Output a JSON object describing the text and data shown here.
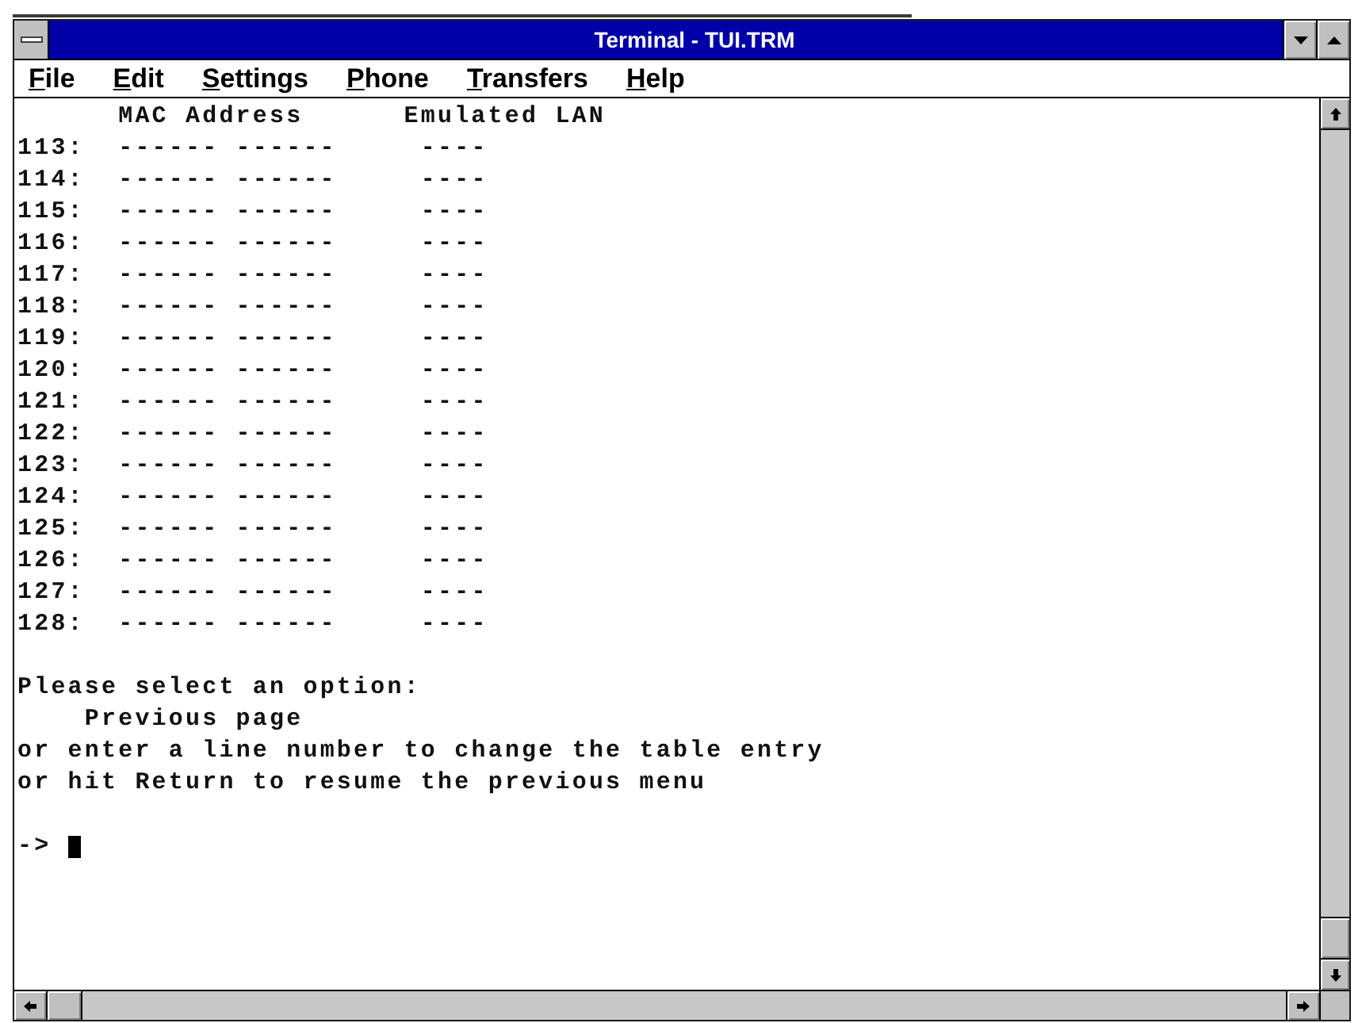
{
  "window": {
    "title": "Terminal - TUI.TRM"
  },
  "menu": [
    "File",
    "Edit",
    "Settings",
    "Phone",
    "Transfers",
    "Help"
  ],
  "terminal": {
    "columns": [
      "MAC Address",
      "Emulated LAN"
    ],
    "rows": [
      {
        "line": "113:",
        "mac_address": "------ ------",
        "emulated_lan": "----"
      },
      {
        "line": "114:",
        "mac_address": "------ ------",
        "emulated_lan": "----"
      },
      {
        "line": "115:",
        "mac_address": "------ ------",
        "emulated_lan": "----"
      },
      {
        "line": "116:",
        "mac_address": "------ ------",
        "emulated_lan": "----"
      },
      {
        "line": "117:",
        "mac_address": "------ ------",
        "emulated_lan": "----"
      },
      {
        "line": "118:",
        "mac_address": "------ ------",
        "emulated_lan": "----"
      },
      {
        "line": "119:",
        "mac_address": "------ ------",
        "emulated_lan": "----"
      },
      {
        "line": "120:",
        "mac_address": "------ ------",
        "emulated_lan": "----"
      },
      {
        "line": "121:",
        "mac_address": "------ ------",
        "emulated_lan": "----"
      },
      {
        "line": "122:",
        "mac_address": "------ ------",
        "emulated_lan": "----"
      },
      {
        "line": "123:",
        "mac_address": "------ ------",
        "emulated_lan": "----"
      },
      {
        "line": "124:",
        "mac_address": "------ ------",
        "emulated_lan": "----"
      },
      {
        "line": "125:",
        "mac_address": "------ ------",
        "emulated_lan": "----"
      },
      {
        "line": "126:",
        "mac_address": "------ ------",
        "emulated_lan": "----"
      },
      {
        "line": "127:",
        "mac_address": "------ ------",
        "emulated_lan": "----"
      },
      {
        "line": "128:",
        "mac_address": "------ ------",
        "emulated_lan": "----"
      }
    ],
    "prompt": "Please select an option:",
    "options": [
      "Previous page"
    ],
    "instructions": [
      "or enter a line number to change the table entry",
      "or hit Return to resume the previous menu"
    ],
    "command_prompt": "->"
  }
}
